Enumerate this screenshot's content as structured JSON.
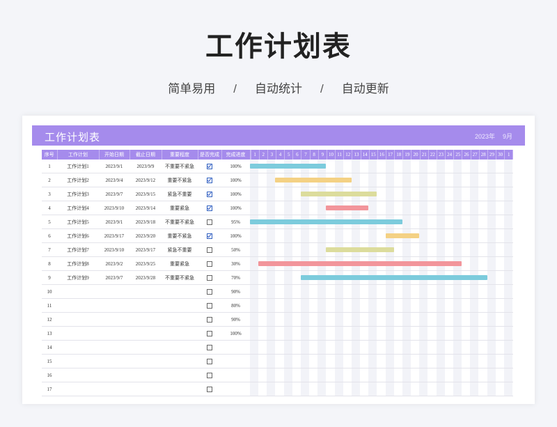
{
  "hero": {
    "title": "工作计划表",
    "tags": [
      "简单易用",
      "自动统计",
      "自动更新"
    ],
    "separator": "/"
  },
  "sheet": {
    "title": "工作计划表",
    "year": "2023年",
    "month": "9月",
    "columns": [
      "序号",
      "工作计划",
      "开始日期",
      "截止日期",
      "重要程度",
      "是否完成",
      "完成进度"
    ],
    "days": [
      "1",
      "2",
      "3",
      "4",
      "5",
      "6",
      "7",
      "8",
      "9",
      "10",
      "11",
      "12",
      "13",
      "14",
      "15",
      "16",
      "17",
      "18",
      "19",
      "20",
      "21",
      "22",
      "23",
      "24",
      "25",
      "26",
      "27",
      "28",
      "29",
      "30",
      "1"
    ],
    "colors": {
      "header": "#a58bec",
      "bar_blue": "#7ccbdc",
      "bar_yellow": "#f4d184",
      "bar_olive": "#dcdc9c",
      "bar_red": "#f2959b"
    },
    "rows": [
      {
        "no": "1",
        "task": "工作计划1",
        "start": "2023/9/1",
        "end": "2023/9/9",
        "priority": "不重要不紧急",
        "done": true,
        "progress": "100%",
        "bar_start": 1,
        "bar_end": 9,
        "bar_color": "bar_blue"
      },
      {
        "no": "2",
        "task": "工作计划2",
        "start": "2023/9/4",
        "end": "2023/9/12",
        "priority": "重要不紧急",
        "done": true,
        "progress": "100%",
        "bar_start": 4,
        "bar_end": 12,
        "bar_color": "bar_yellow"
      },
      {
        "no": "3",
        "task": "工作计划3",
        "start": "2023/9/7",
        "end": "2023/9/15",
        "priority": "紧急不重要",
        "done": true,
        "progress": "100%",
        "bar_start": 7,
        "bar_end": 15,
        "bar_color": "bar_olive"
      },
      {
        "no": "4",
        "task": "工作计划4",
        "start": "2023/9/10",
        "end": "2023/9/14",
        "priority": "重要紧急",
        "done": true,
        "progress": "100%",
        "bar_start": 10,
        "bar_end": 14,
        "bar_color": "bar_red"
      },
      {
        "no": "5",
        "task": "工作计划5",
        "start": "2023/9/1",
        "end": "2023/9/18",
        "priority": "不重要不紧急",
        "done": false,
        "progress": "95%",
        "bar_start": 1,
        "bar_end": 18,
        "bar_color": "bar_blue"
      },
      {
        "no": "6",
        "task": "工作计划6",
        "start": "2023/9/17",
        "end": "2023/9/20",
        "priority": "重要不紧急",
        "done": true,
        "progress": "100%",
        "bar_start": 17,
        "bar_end": 20,
        "bar_color": "bar_yellow"
      },
      {
        "no": "7",
        "task": "工作计划7",
        "start": "2023/9/10",
        "end": "2023/9/17",
        "priority": "紧急不重要",
        "done": false,
        "progress": "50%",
        "bar_start": 10,
        "bar_end": 17,
        "bar_color": "bar_olive"
      },
      {
        "no": "8",
        "task": "工作计划8",
        "start": "2023/9/2",
        "end": "2023/9/25",
        "priority": "重要紧急",
        "done": false,
        "progress": "30%",
        "bar_start": 2,
        "bar_end": 25,
        "bar_color": "bar_red"
      },
      {
        "no": "9",
        "task": "工作计划9",
        "start": "2023/9/7",
        "end": "2023/9/28",
        "priority": "不重要不紧急",
        "done": false,
        "progress": "70%",
        "bar_start": 7,
        "bar_end": 28,
        "bar_color": "bar_blue"
      },
      {
        "no": "10",
        "task": "",
        "start": "",
        "end": "",
        "priority": "",
        "done": false,
        "progress": "90%"
      },
      {
        "no": "11",
        "task": "",
        "start": "",
        "end": "",
        "priority": "",
        "done": false,
        "progress": "80%"
      },
      {
        "no": "12",
        "task": "",
        "start": "",
        "end": "",
        "priority": "",
        "done": false,
        "progress": "90%"
      },
      {
        "no": "13",
        "task": "",
        "start": "",
        "end": "",
        "priority": "",
        "done": false,
        "progress": "100%"
      },
      {
        "no": "14",
        "task": "",
        "start": "",
        "end": "",
        "priority": "",
        "done": false,
        "progress": ""
      },
      {
        "no": "15",
        "task": "",
        "start": "",
        "end": "",
        "priority": "",
        "done": false,
        "progress": ""
      },
      {
        "no": "16",
        "task": "",
        "start": "",
        "end": "",
        "priority": "",
        "done": false,
        "progress": ""
      },
      {
        "no": "17",
        "task": "",
        "start": "",
        "end": "",
        "priority": "",
        "done": false,
        "progress": ""
      }
    ]
  }
}
